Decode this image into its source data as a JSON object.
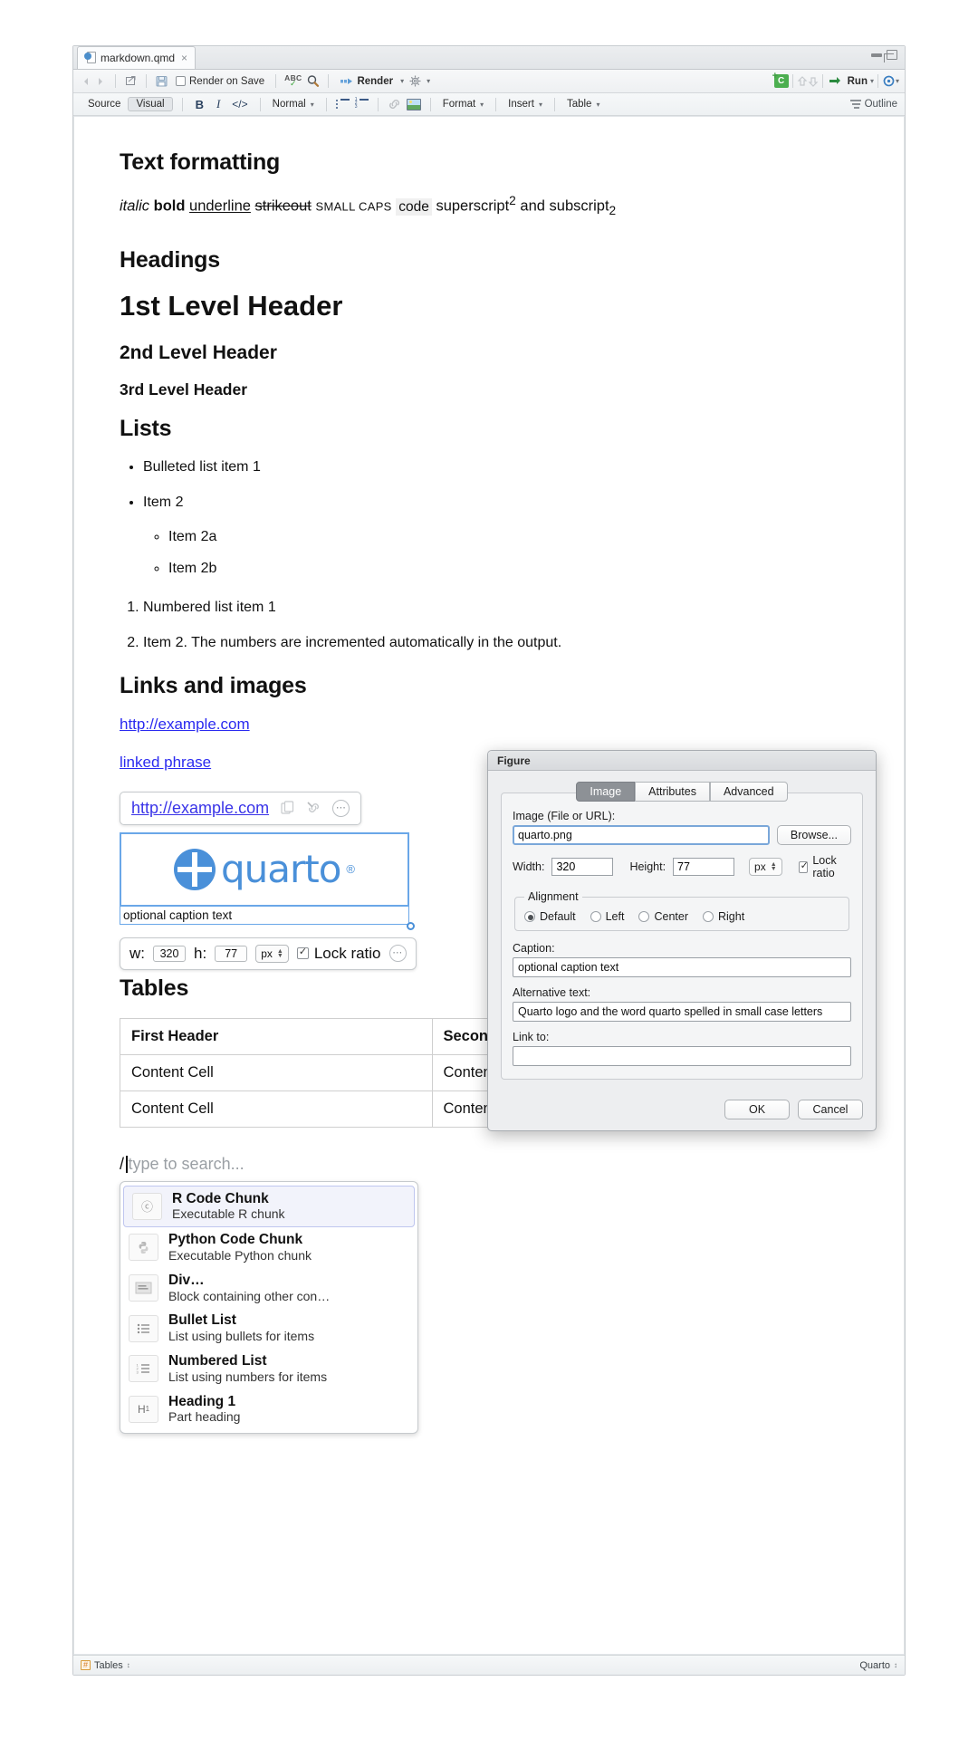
{
  "window": {
    "tab_title": "markdown.qmd",
    "tab_close": "×"
  },
  "toolbar_main": {
    "render_on_save_label": "Render on Save",
    "render_label": "Render",
    "run_label": "Run",
    "spell_abc": "ABC",
    "spell_check": "✓"
  },
  "toolbar_visual": {
    "source_label": "Source",
    "visual_label": "Visual",
    "bold_label": "B",
    "italic_label": "I",
    "code_label": "</>",
    "block_style": "Normal",
    "format_label": "Format",
    "insert_label": "Insert",
    "table_label": "Table",
    "outline_label": "Outline",
    "caret": "▾"
  },
  "document": {
    "sections": {
      "text_formatting_heading": "Text formatting",
      "formatting_sample": {
        "italic": "italic",
        "bold": "bold",
        "underline": "underline",
        "strikeout": "strikeout",
        "small_caps": "SMALL CAPS",
        "code": "code",
        "superscript_word": "superscript",
        "superscript_value": "2",
        "and": " and ",
        "subscript_word": "subscript",
        "subscript_value": "2"
      },
      "headings_heading": "Headings",
      "h1": "1st Level Header",
      "h2": "2nd Level Header",
      "h3": "3rd Level Header",
      "lists_heading": "Lists",
      "bullets": [
        "Bulleted list item 1",
        "Item 2"
      ],
      "nested_bullets": [
        "Item 2a",
        "Item 2b"
      ],
      "numbered": [
        "Numbered list item 1",
        "Item 2. The numbers are incremented automatically in the output."
      ],
      "links_heading": "Links and images",
      "link_url": "http://example.com",
      "linked_phrase": "linked phrase",
      "tables_heading": "Tables"
    },
    "link_popup": {
      "url": "http://example.com",
      "copy_icon": "copy-icon",
      "remove_link_icon": "remove-link-icon",
      "more_icon": "⋯"
    },
    "image": {
      "logo_text": "quarto",
      "registered_mark": "®",
      "caption": "optional caption text"
    },
    "image_toolbar": {
      "width_label": "w:",
      "width_value": "320",
      "height_label": "h:",
      "height_value": "77",
      "unit": "px",
      "lock_label": "Lock ratio",
      "more_icon": "⋯"
    },
    "table": {
      "headers": [
        "First Header",
        "Second Header"
      ],
      "rows": [
        [
          "Content Cell",
          "Content Cell"
        ],
        [
          "Content Cell",
          "Content Cell"
        ]
      ]
    },
    "slash_menu": {
      "trigger": "/",
      "placeholder": "type to search...",
      "items": [
        {
          "title": "R Code Chunk",
          "desc": "Executable R chunk",
          "icon": "r-logo-icon",
          "glyph": "Ⓡ",
          "selected": true
        },
        {
          "title": "Python Code Chunk",
          "desc": "Executable Python chunk",
          "icon": "python-logo-icon",
          "glyph": "🐍",
          "selected": false
        },
        {
          "title": "Div…",
          "desc": "Block containing other con…",
          "icon": "div-block-icon",
          "glyph": "▤",
          "selected": false
        },
        {
          "title": "Bullet List",
          "desc": "List using bullets for items",
          "icon": "bullet-list-icon",
          "glyph": "☰",
          "selected": false
        },
        {
          "title": "Numbered List",
          "desc": "List using numbers for items",
          "icon": "numbered-list-icon",
          "glyph": "☰",
          "selected": false
        },
        {
          "title": "Heading 1",
          "desc": "Part heading",
          "icon": "heading-1-icon",
          "glyph": "H₁",
          "selected": false
        }
      ]
    }
  },
  "figure_dialog": {
    "title": "Figure",
    "tabs": [
      {
        "label": "Image",
        "active": true
      },
      {
        "label": "Attributes",
        "active": false
      },
      {
        "label": "Advanced",
        "active": false
      }
    ],
    "image_field_label": "Image (File or URL):",
    "image_field_value": "quarto.png",
    "browse_label": "Browse...",
    "width_label": "Width:",
    "width_value": "320",
    "height_label": "Height:",
    "height_value": "77",
    "unit": "px",
    "lock_ratio_label": "Lock ratio",
    "alignment_legend": "Alignment",
    "alignment_options": [
      {
        "label": "Default",
        "selected": true
      },
      {
        "label": "Left",
        "selected": false
      },
      {
        "label": "Center",
        "selected": false
      },
      {
        "label": "Right",
        "selected": false
      }
    ],
    "caption_label": "Caption:",
    "caption_value": "optional caption text",
    "alt_label": "Alternative text:",
    "alt_value": "Quarto logo and the word quarto spelled in small case letters",
    "link_label": "Link to:",
    "link_value": "",
    "ok_label": "OK",
    "cancel_label": "Cancel"
  },
  "statusbar": {
    "left_label": "Tables",
    "right_label": "Quarto",
    "stepper": "↕"
  },
  "colors": {
    "accent_blue": "#4a90d9",
    "link_blue": "#2a2af0",
    "selection_blue": "#6aa7e8",
    "render_green": "#4caf50"
  }
}
